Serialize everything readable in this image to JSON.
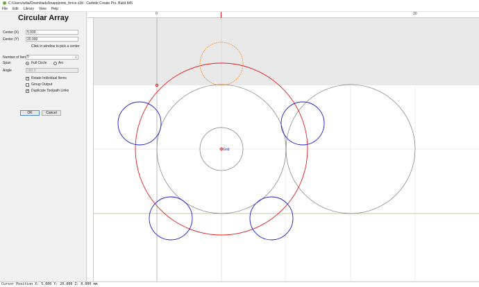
{
  "window": {
    "title": "C:/Users/wilia/Downloads/knappjoints_thrice.c2d - Carbide Create Pro, Build 845"
  },
  "menu": [
    "File",
    "Edit",
    "Library",
    "View",
    "Help"
  ],
  "panel": {
    "title": "Circular Array",
    "center_x_label": "Center (X)",
    "center_x_value": "5.000",
    "center_y_label": "Center (Y)",
    "center_y_value": "20.000",
    "pick_hint": "Click in window to pick a center",
    "num_items_label": "Number of Items",
    "num_items_value": "5",
    "span_label": "Span",
    "span_options": [
      "Full Circle",
      "Arc"
    ],
    "span_selected": "Full Circle",
    "angle_label": "Angle",
    "angle_value": "180.0",
    "rotate_label": "Rotate Individual Items",
    "rotate_checked": true,
    "group_label": "Group Output",
    "group_checked": false,
    "duplicate_label": "Duplicate Toolpath Links",
    "duplicate_checked": true,
    "ok_label": "OK",
    "cancel_label": "Cancel"
  },
  "ruler": {
    "top_ticks": [
      "0",
      "20"
    ]
  },
  "canvas": {
    "origin_label": "Grid",
    "colors": {
      "array_circle": "#e01a1a",
      "selected_copy": "#ff8c1a",
      "array_items": "#1a1acc",
      "geometry": "#7a7a7a",
      "axis": "#b0b0b0",
      "stock_edge": "#b5b58a"
    }
  },
  "status": {
    "cursor_position": "Cursor Position X: 5.000 Y: 20.000 Z: 0.000 mm"
  }
}
